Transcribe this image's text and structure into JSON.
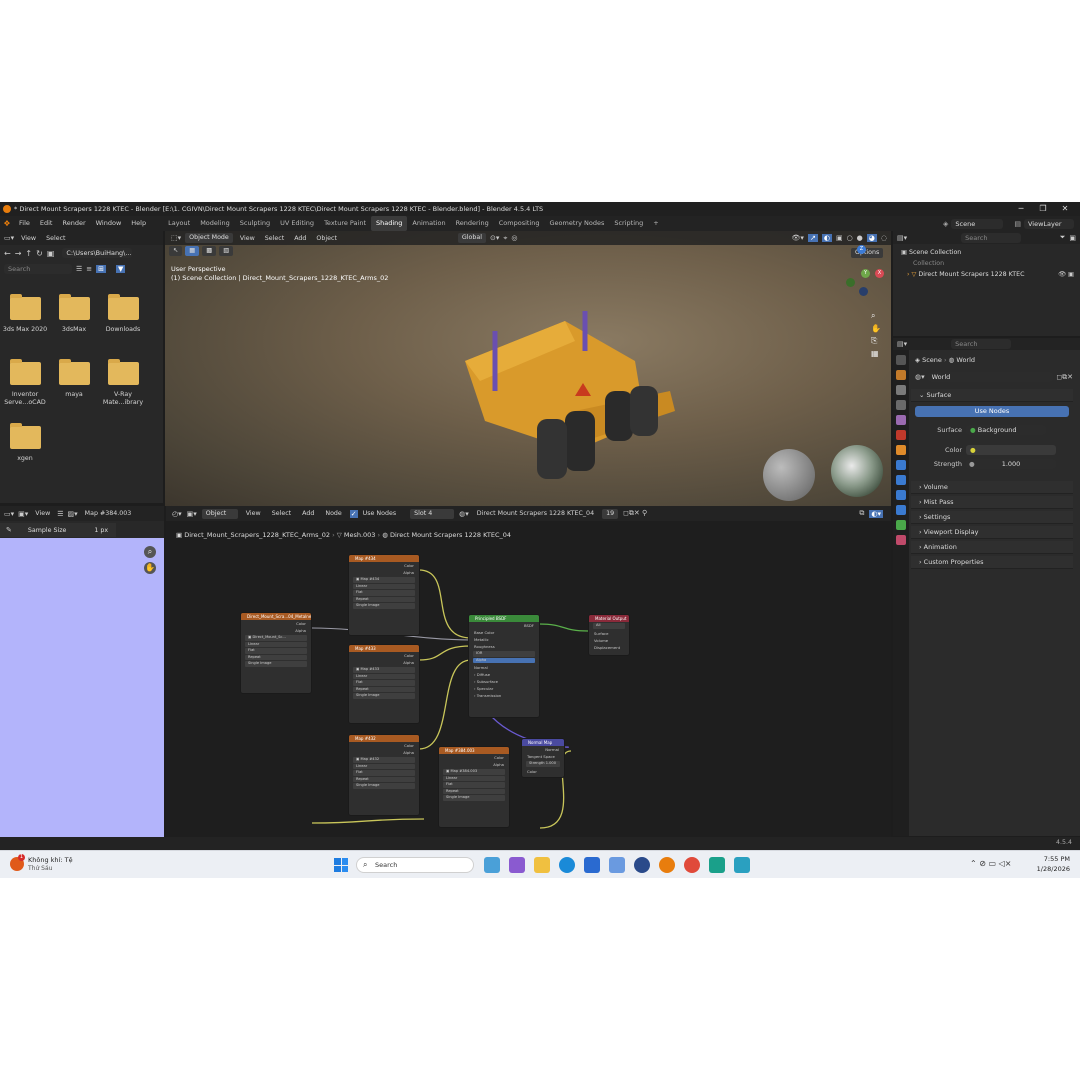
{
  "window": {
    "title": "* Direct Mount Scrapers 1228 KTEC - Blender [E:\\1. CGIVN\\Direct Mount Scrapers 1228 KTEC\\Direct Mount Scrapers 1228 KTEC - Blender.blend] - Blender 4.5.4 LTS",
    "minimize": "─",
    "maximize": "❐",
    "close": "✕"
  },
  "menu": {
    "items": [
      "File",
      "Edit",
      "Render",
      "Window",
      "Help"
    ],
    "workspaces": [
      "Layout",
      "Modeling",
      "Sculpting",
      "UV Editing",
      "Texture Paint",
      "Shading",
      "Animation",
      "Rendering",
      "Compositing",
      "Geometry Nodes",
      "Scripting"
    ],
    "active_workspace": "Shading",
    "add_tab": "+",
    "scene": "Scene",
    "view_layer": "ViewLayer"
  },
  "filebrowser": {
    "view": "View",
    "select": "Select",
    "path": "C:\\Users\\BuiHang\\...",
    "search_placeholder": "Search",
    "folders": [
      "3ds Max 2020",
      "3dsMax",
      "Downloads",
      "Inventor Serve...oCAD",
      "maya",
      "V-Ray Mate...ibrary",
      "xgen"
    ]
  },
  "viewport": {
    "mode": "Object Mode",
    "view": "View",
    "select": "Select",
    "add": "Add",
    "object": "Object",
    "orientation": "Global",
    "options": "Options",
    "overlay_title": "User Perspective",
    "overlay_sub": "(1) Scene Collection | Direct_Mount_Scrapers_1228_KTEC_Arms_02",
    "gizmo": {
      "x": "X",
      "y": "Y",
      "z": "Z"
    }
  },
  "outliner": {
    "search_placeholder": "Search",
    "root": "Scene Collection",
    "collection": "Collection",
    "object": "Direct Mount Scrapers 1228 KTEC"
  },
  "properties": {
    "search_placeholder": "Search",
    "breadcrumb_scene": "Scene",
    "breadcrumb_world": "World",
    "world_name": "World",
    "surface": "Surface",
    "use_nodes": "Use Nodes",
    "surface_label": "Surface",
    "surface_value": "Background",
    "color_label": "Color",
    "strength_label": "Strength",
    "strength_value": "1.000",
    "sections": [
      "Volume",
      "Mist Pass",
      "Settings",
      "Viewport Display",
      "Animation",
      "Custom Properties"
    ]
  },
  "imageeditor": {
    "view": "View",
    "image_name": "Map #384.003",
    "tool_label": "Sample Size",
    "tool_value": "1 px"
  },
  "nodeeditor": {
    "object": "Object",
    "view": "View",
    "select": "Select",
    "add": "Add",
    "node": "Node",
    "use_nodes": "Use Nodes",
    "slot": "Slot 4",
    "material": "Direct Mount Scrapers 1228 KTEC_04",
    "users": "19",
    "bc_object": "Direct_Mount_Scrapers_1228_KTEC_Arms_02",
    "bc_mesh": "Mesh.003",
    "bc_material": "Direct Mount Scrapers 1228 KTEC_04"
  },
  "statusbar": {
    "version": "4.5.4"
  },
  "taskbar": {
    "weather_title": "Không khí: Tệ",
    "weather_sub": "Thứ Sáu",
    "weather_badge": "1",
    "search_placeholder": "Search",
    "time": "7:55 PM",
    "date": "1/28/2026"
  },
  "colors": {
    "accent_blue": "#4772b3",
    "blender_orange": "#e87d0d",
    "uv_background": "#b3b4fb"
  }
}
